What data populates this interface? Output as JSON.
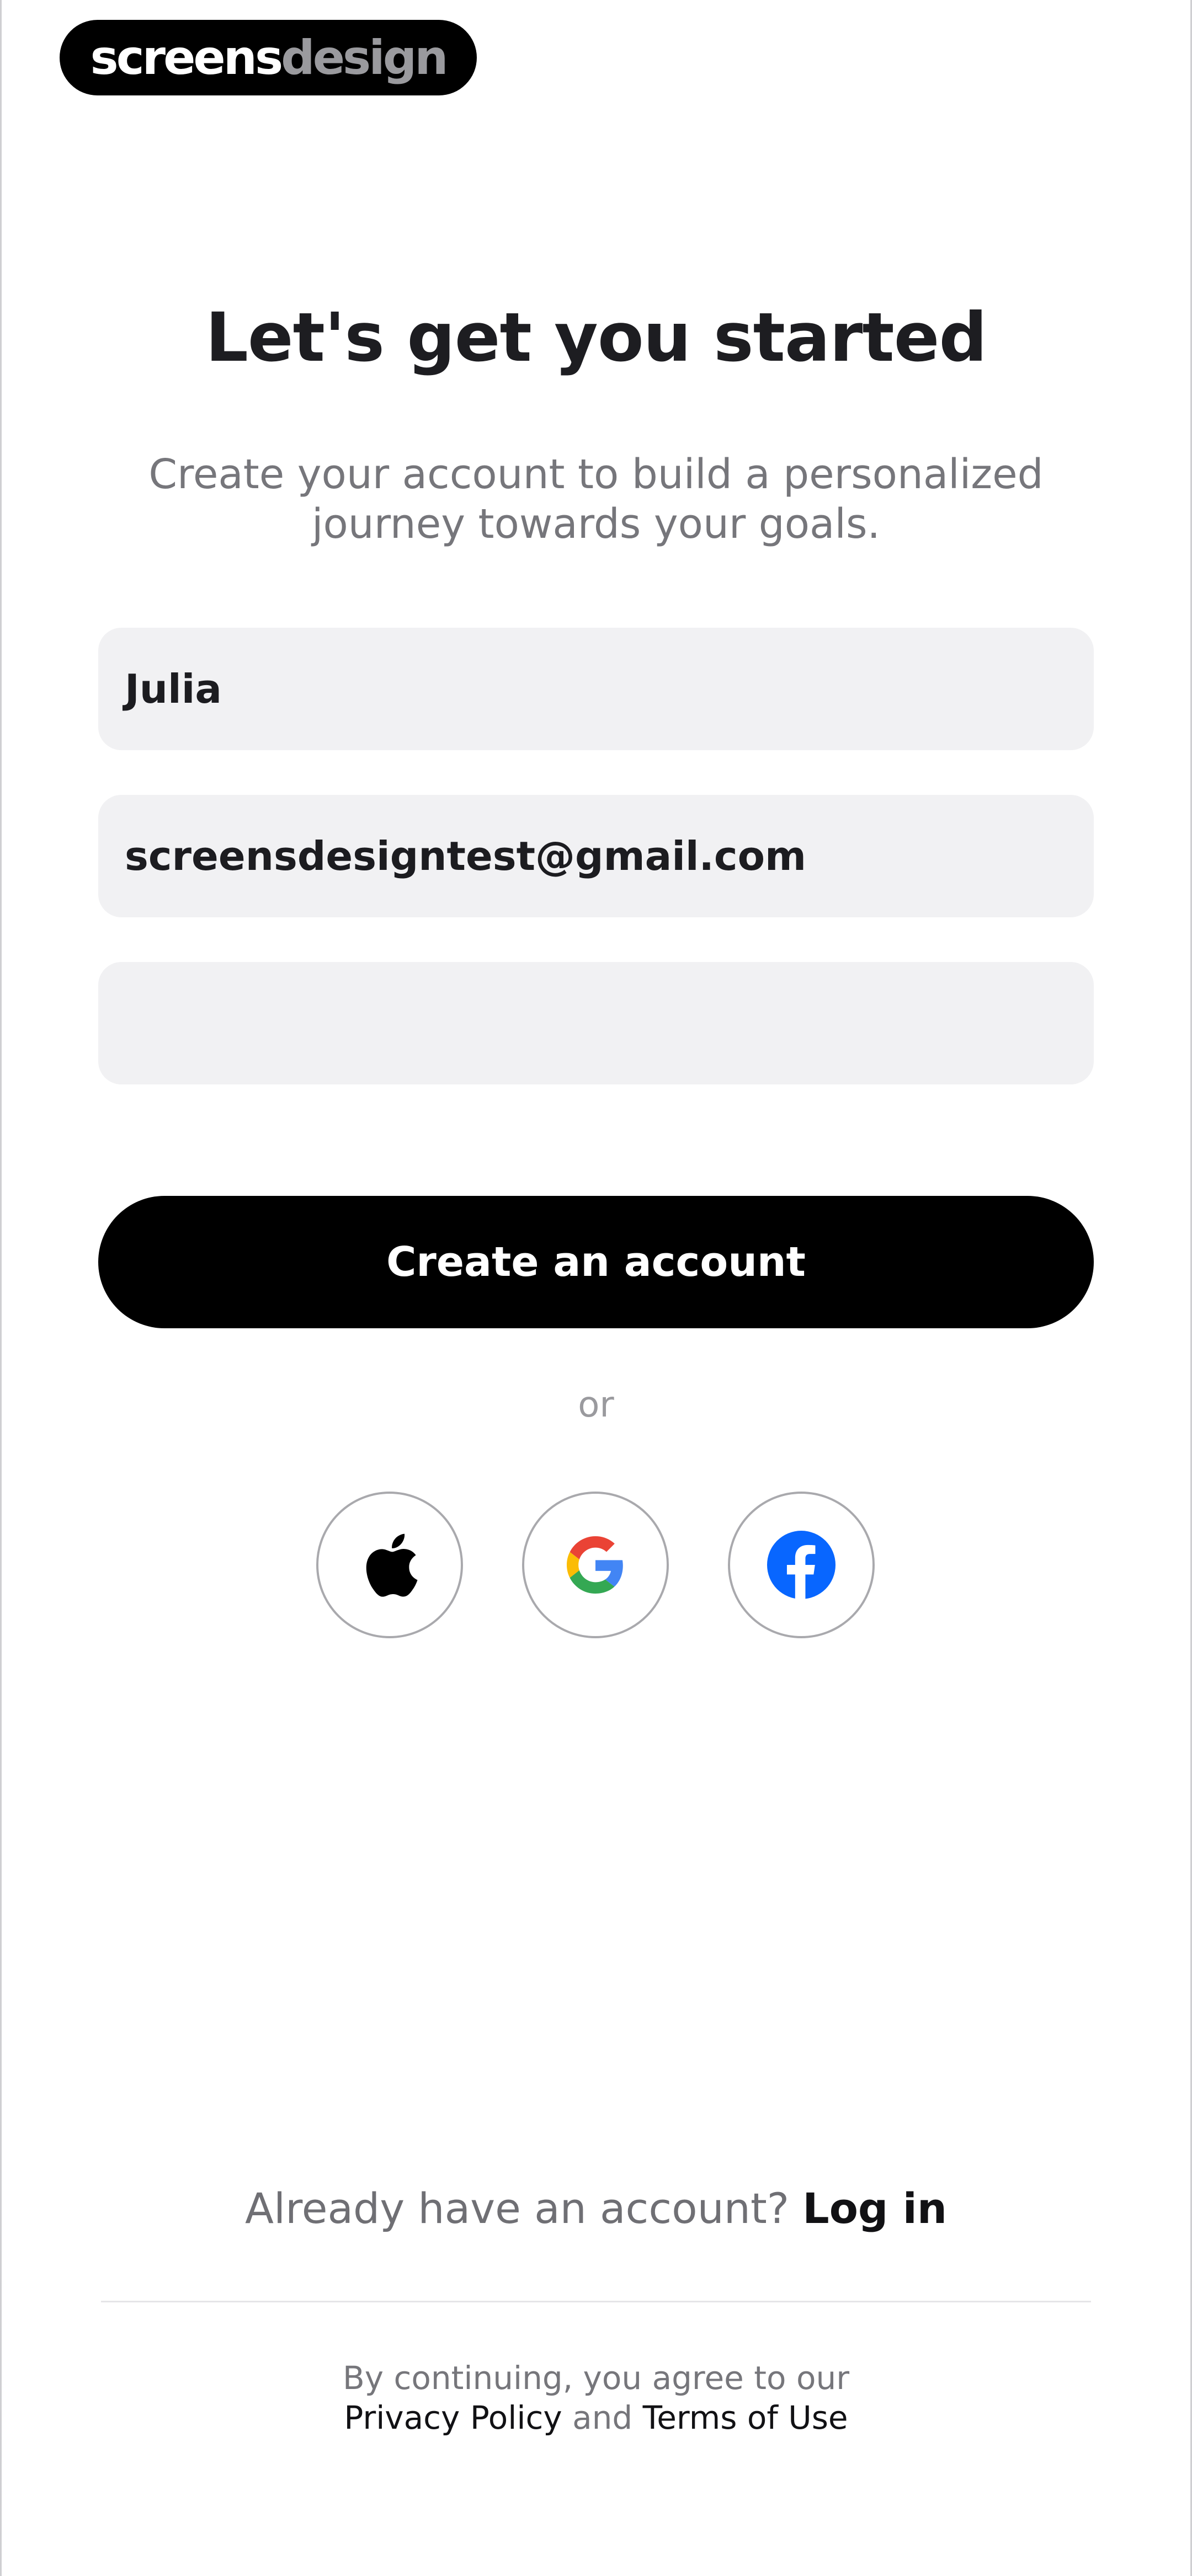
{
  "brand": {
    "part1": "screens",
    "part2": "design"
  },
  "header": {
    "title": "Let's get you started",
    "subtitle": "Create your account to build a personalized journey towards your goals."
  },
  "form": {
    "name_value": "Julia",
    "email_value": "screensdesigntest@gmail.com",
    "password_value": "",
    "submit_label": "Create an account"
  },
  "divider_text": "or",
  "social": [
    {
      "icon": "apple-icon"
    },
    {
      "icon": "google-icon"
    },
    {
      "icon": "facebook-icon"
    }
  ],
  "login": {
    "question": "Already have an account?",
    "link": "Log in"
  },
  "legal": {
    "prefix": "By continuing, you agree to our",
    "privacy": "Privacy Policy",
    "and": "and",
    "terms": "Terms of Use"
  },
  "colors": {
    "primary": "#000000",
    "field_background": "#f1f1f3",
    "muted_text": "#76767b",
    "facebook_blue": "#0866ff"
  }
}
